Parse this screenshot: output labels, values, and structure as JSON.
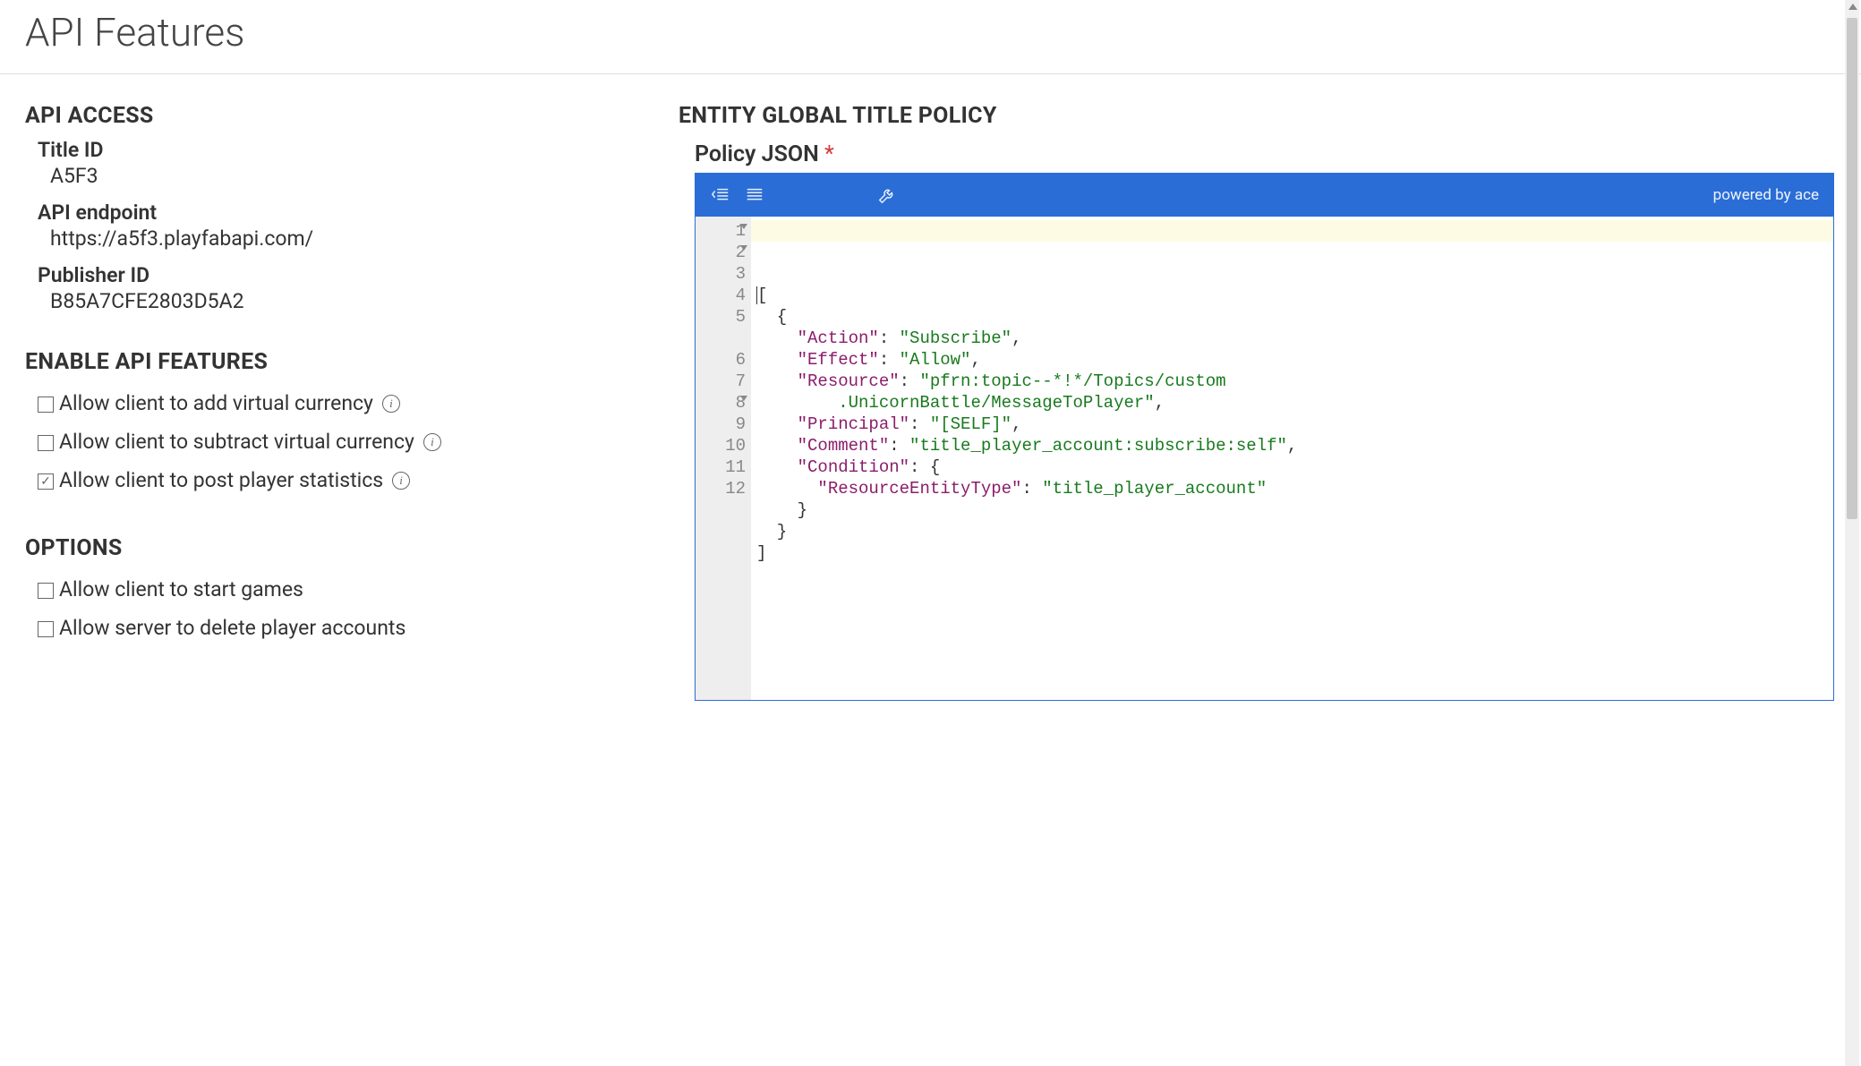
{
  "page": {
    "title": "API Features"
  },
  "api_access": {
    "heading": "API ACCESS",
    "title_id": {
      "label": "Title ID",
      "value": "A5F3"
    },
    "endpoint": {
      "label": "API endpoint",
      "value": "https://a5f3.playfabapi.com/"
    },
    "publisher_id": {
      "label": "Publisher ID",
      "value": "B85A7CFE2803D5A2"
    }
  },
  "enable_features": {
    "heading": "ENABLE API FEATURES",
    "items": [
      {
        "label": "Allow client to add virtual currency",
        "checked": false
      },
      {
        "label": "Allow client to subtract virtual currency",
        "checked": false
      },
      {
        "label": "Allow client to post player statistics",
        "checked": true
      }
    ]
  },
  "options": {
    "heading": "OPTIONS",
    "items": [
      {
        "label": "Allow client to start games",
        "checked": false
      },
      {
        "label": "Allow server to delete player accounts",
        "checked": false
      }
    ]
  },
  "policy": {
    "heading": "ENTITY GLOBAL TITLE POLICY",
    "label": "Policy JSON",
    "required_mark": "*",
    "powered_by": "powered by ace",
    "gutter_lines": [
      {
        "n": "1",
        "fold": true
      },
      {
        "n": "2",
        "fold": true
      },
      {
        "n": "3",
        "fold": false
      },
      {
        "n": "4",
        "fold": false
      },
      {
        "n": "5",
        "fold": false
      },
      {
        "n": "6",
        "fold": false
      },
      {
        "n": "7",
        "fold": false
      },
      {
        "n": "8",
        "fold": true
      },
      {
        "n": "9",
        "fold": false
      },
      {
        "n": "10",
        "fold": false
      },
      {
        "n": "11",
        "fold": false
      },
      {
        "n": "12",
        "fold": false
      }
    ],
    "code_lines": [
      [
        {
          "t": "[",
          "c": "brace"
        }
      ],
      [
        {
          "t": "  {",
          "c": "brace"
        }
      ],
      [
        {
          "t": "    ",
          "c": "punc"
        },
        {
          "t": "\"Action\"",
          "c": "key"
        },
        {
          "t": ": ",
          "c": "punc"
        },
        {
          "t": "\"Subscribe\"",
          "c": "str"
        },
        {
          "t": ",",
          "c": "punc"
        }
      ],
      [
        {
          "t": "    ",
          "c": "punc"
        },
        {
          "t": "\"Effect\"",
          "c": "key"
        },
        {
          "t": ": ",
          "c": "punc"
        },
        {
          "t": "\"Allow\"",
          "c": "str"
        },
        {
          "t": ",",
          "c": "punc"
        }
      ],
      [
        {
          "t": "    ",
          "c": "punc"
        },
        {
          "t": "\"Resource\"",
          "c": "key"
        },
        {
          "t": ": ",
          "c": "punc"
        },
        {
          "t": "\"pfrn:topic--*!*/Topics/custom\n        .UnicornBattle/MessageToPlayer\"",
          "c": "str"
        },
        {
          "t": ",",
          "c": "punc"
        }
      ],
      [
        {
          "t": "    ",
          "c": "punc"
        },
        {
          "t": "\"Principal\"",
          "c": "key"
        },
        {
          "t": ": ",
          "c": "punc"
        },
        {
          "t": "\"[SELF]\"",
          "c": "str"
        },
        {
          "t": ",",
          "c": "punc"
        }
      ],
      [
        {
          "t": "    ",
          "c": "punc"
        },
        {
          "t": "\"Comment\"",
          "c": "key"
        },
        {
          "t": ": ",
          "c": "punc"
        },
        {
          "t": "\"title_player_account:subscribe:self\"",
          "c": "str"
        },
        {
          "t": ",",
          "c": "punc"
        }
      ],
      [
        {
          "t": "    ",
          "c": "punc"
        },
        {
          "t": "\"Condition\"",
          "c": "key"
        },
        {
          "t": ": {",
          "c": "punc"
        }
      ],
      [
        {
          "t": "      ",
          "c": "punc"
        },
        {
          "t": "\"ResourceEntityType\"",
          "c": "key"
        },
        {
          "t": ": ",
          "c": "punc"
        },
        {
          "t": "\"title_player_account\"",
          "c": "str"
        }
      ],
      [
        {
          "t": "    }",
          "c": "brace"
        }
      ],
      [
        {
          "t": "  }",
          "c": "brace"
        }
      ],
      [
        {
          "t": "]",
          "c": "brace"
        }
      ]
    ]
  }
}
